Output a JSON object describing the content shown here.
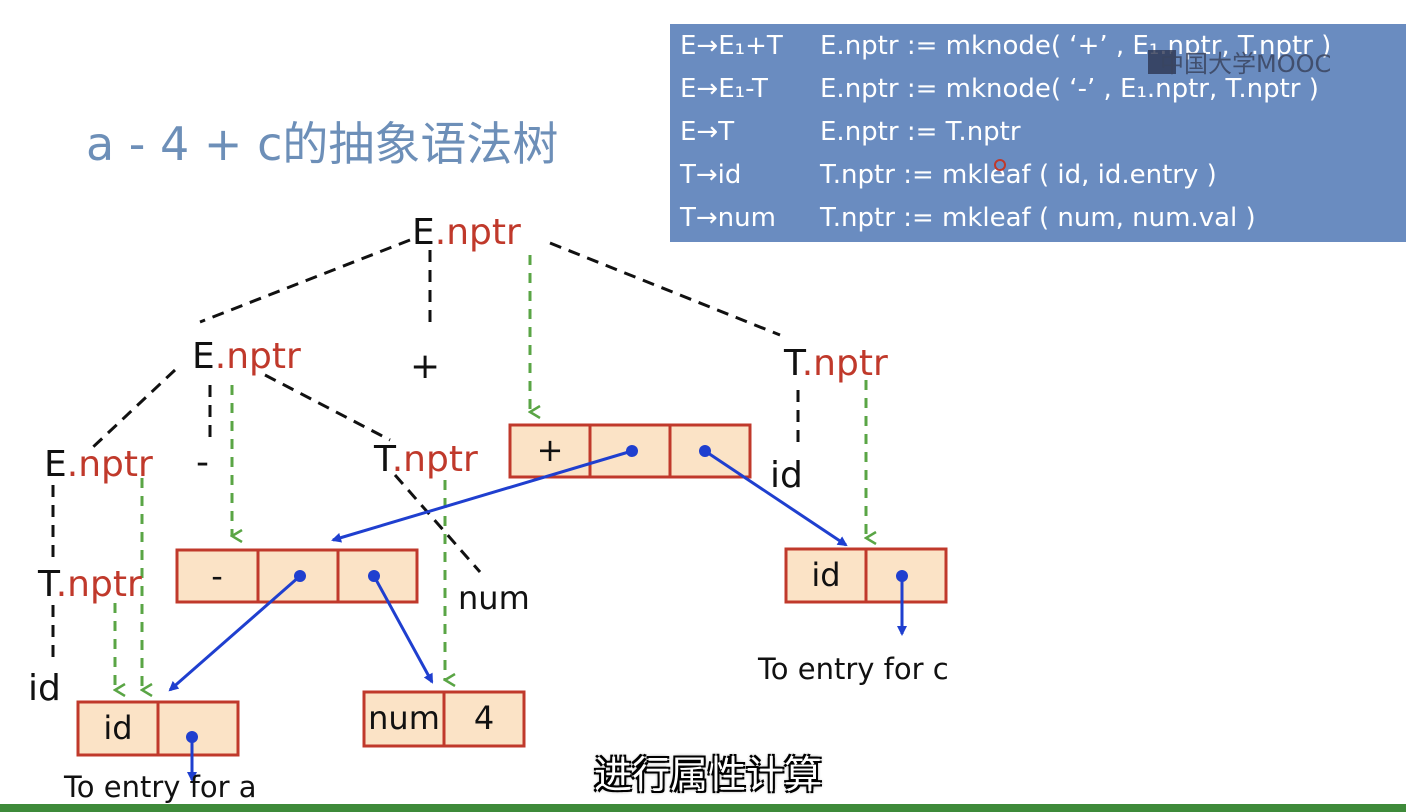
{
  "title": "a - 4 + c的抽象语法树",
  "rules": [
    {
      "prod": "E→E₁+T",
      "act": "E.nptr := mknode(   ‘+’  , E₁.nptr, T.nptr )"
    },
    {
      "prod": "E→E₁-T",
      "act": "E.nptr := mknode(   ‘-’  , E₁.nptr, T.nptr )"
    },
    {
      "prod": "E→T",
      "act": "E.nptr := T.nptr"
    },
    {
      "prod": "T→id",
      "act": "T.nptr := mkleaf ( id, id.entry )"
    },
    {
      "prod": "T→num",
      "act": "T.nptr := mkleaf ( num, num.val )"
    }
  ],
  "watermark": "中国大学MOOC",
  "parse_tree": {
    "root": {
      "sym": "E",
      "attr": ".nptr"
    },
    "e_left": {
      "sym": "E",
      "attr": ".nptr"
    },
    "plus": "+",
    "t_right": {
      "sym": "T",
      "attr": ".nptr"
    },
    "e_ll": {
      "sym": "E",
      "attr": ".nptr"
    },
    "minus": "-",
    "t_mid": {
      "sym": "T",
      "attr": ".nptr"
    },
    "t_ll": {
      "sym": "T",
      "attr": ".nptr"
    },
    "id_left": "id",
    "num_leaf": "num",
    "id_right": "id"
  },
  "nodes": {
    "plus_node": {
      "op": "+"
    },
    "minus_node": {
      "op": "-"
    },
    "id_c": {
      "label": "id"
    },
    "id_a": {
      "label": "id"
    },
    "num_4": {
      "label": "num",
      "value": "4"
    }
  },
  "entry_c": "To entry for c",
  "entry_a": "To entry for a",
  "caption": "进行属性计算",
  "colors": {
    "attr": "#c0392b",
    "green": "#5aa545",
    "blue": "#1f3fcf",
    "box_fill": "#fbe3c6",
    "box_stroke": "#c0392b",
    "rules_bg": "#6a8cc0",
    "title": "#6d8fb8"
  }
}
